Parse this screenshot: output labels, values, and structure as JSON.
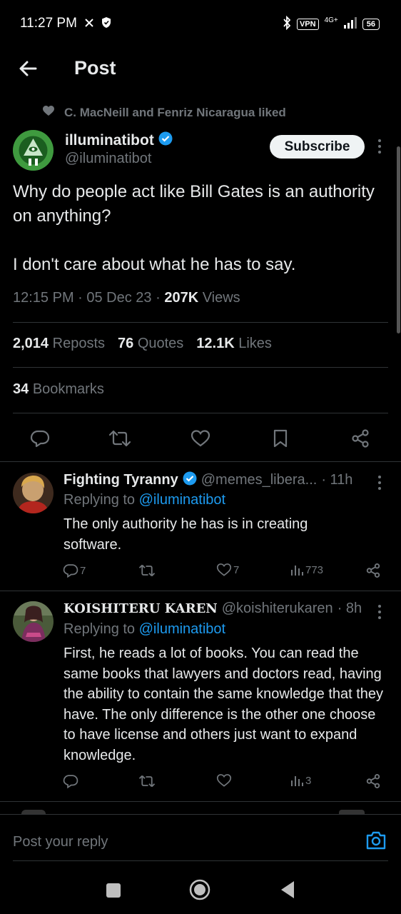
{
  "status_bar": {
    "time": "11:27 PM",
    "vpn": "VPN",
    "network": "4G+",
    "battery": "56"
  },
  "header": {
    "title": "Post"
  },
  "social_context": {
    "text": "C. MacNeill and Fenriz Nicaragua liked"
  },
  "author": {
    "name": "illuminatibot",
    "handle": "@iluminatibot",
    "subscribe_label": "Subscribe"
  },
  "tweet": {
    "paragraphs": [
      "Why do people act like Bill Gates is an authority on anything?",
      "I don't care about what he has to say."
    ],
    "time": "12:15 PM · 05 Dec 23 · ",
    "views_count": "207K",
    "views_label": " Views"
  },
  "stats": {
    "reposts_count": "2,014",
    "reposts_label": "Reposts",
    "quotes_count": "76",
    "quotes_label": "Quotes",
    "likes_count": "12.1K",
    "likes_label": "Likes",
    "bookmarks_count": "34",
    "bookmarks_label": "Bookmarks"
  },
  "replies": [
    {
      "name": "Fighting Tyranny",
      "handle": "@memes_libera...",
      "time": "· 11h",
      "replying_prefix": "Replying to ",
      "replying_to": "@iluminatibot",
      "text": "The only authority he has is in creating software.",
      "replies_count": "7",
      "likes_count": "7",
      "views_count": "773"
    },
    {
      "name": "KOISHITERU KAREN",
      "handle": "@koishiterukaren",
      "time": "· 8h",
      "replying_prefix": "Replying to ",
      "replying_to": "@iluminatibot",
      "text": "First, he reads a lot of books. You can read the same books that lawyers and doctors read, having the ability to contain the same knowledge that they have. The only difference is the other one choose to have license and others just want to expand knowledge.",
      "views_count": "3"
    }
  ],
  "reply_composer": {
    "placeholder": "Post your reply"
  },
  "colors": {
    "background": "#000000",
    "text": "#e7e9ea",
    "secondary": "#71767b",
    "accent": "#1d9bf0",
    "divider": "#2f3336"
  }
}
